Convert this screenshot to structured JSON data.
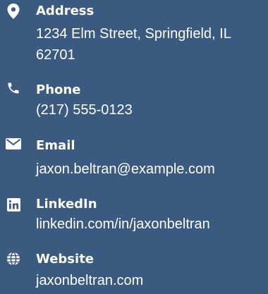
{
  "contact": {
    "items": [
      {
        "icon": "map-pin-icon",
        "label": "Address",
        "value": "1234 Elm Street, Springfield, IL 62701"
      },
      {
        "icon": "phone-icon",
        "label": "Phone",
        "value": "(217) 555-0123"
      },
      {
        "icon": "envelope-icon",
        "label": "Email",
        "value": "jaxon.beltran@example.com"
      },
      {
        "icon": "linkedin-icon",
        "label": "LinkedIn",
        "value": "linkedin.com/in/jaxonbeltran"
      },
      {
        "icon": "globe-icon",
        "label": "Website",
        "value": "jaxonbeltran.com"
      }
    ]
  },
  "colors": {
    "background": "#3a5a80",
    "text": "#ffffff"
  }
}
